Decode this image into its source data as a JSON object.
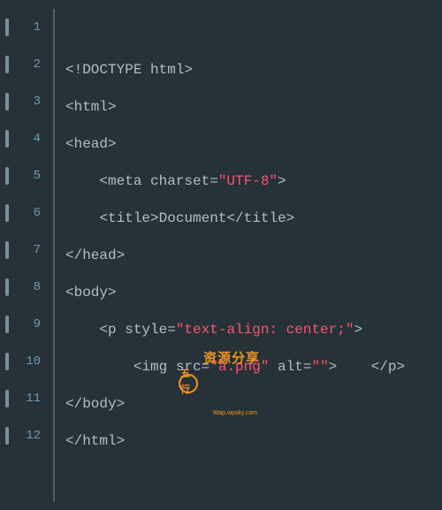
{
  "gutter": {
    "lines": [
      "1",
      "2",
      "3",
      "4",
      "5",
      "6",
      "7",
      "8",
      "9",
      "10",
      "11",
      "12"
    ]
  },
  "watermark": {
    "icon_text": "五行",
    "main_text": "资源分享",
    "sub_text": "Wap.wpsky.com"
  },
  "code": {
    "l1_tag": "<!DOCTYPE html>",
    "l2_tag": "<html>",
    "l3_tag": "<head>",
    "l4_open": "    <meta charset=",
    "l4_val": "\"UTF-8\"",
    "l4_close": ">",
    "l5_open": "    <title>",
    "l5_text": "Document",
    "l5_close": "</title>",
    "l6_tag": "</head>",
    "l7_tag": "<body>",
    "l8_open": "    <p style=",
    "l8_val": "\"text-align: center;\"",
    "l8_close": ">",
    "l9_open": "        <img src=",
    "l9_src": "\"a.png\"",
    "l9_alt_attr": " alt=",
    "l9_alt": "\"\"",
    "l9_close": ">    </p>",
    "l10_tag": "</body>",
    "l11_tag": "</html>"
  }
}
